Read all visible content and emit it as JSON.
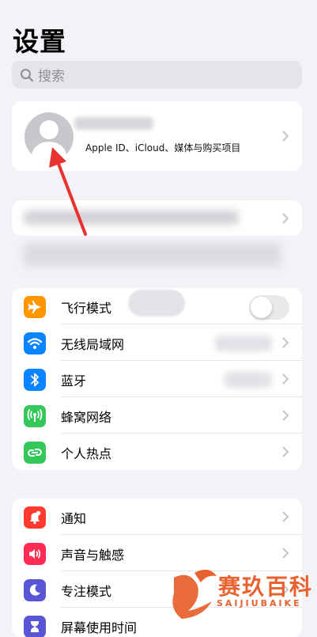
{
  "page_title": "设置",
  "search": {
    "placeholder": "搜索",
    "icon": "search-icon"
  },
  "profile": {
    "subtitle": "Apple ID、iCloud、媒体与购买项目"
  },
  "group1": [
    {
      "label": "飞行模式",
      "icon": "airplane-icon",
      "color": "#ff9500",
      "accessory": "toggle",
      "toggle_on": false
    },
    {
      "label": "无线局域网",
      "icon": "wifi-icon",
      "color": "#0a84ff",
      "accessory": "chevron"
    },
    {
      "label": "蓝牙",
      "icon": "bluetooth-icon",
      "color": "#0a84ff",
      "accessory": "chevron"
    },
    {
      "label": "蜂窝网络",
      "icon": "cellular-icon",
      "color": "#34c759",
      "accessory": "chevron"
    },
    {
      "label": "个人热点",
      "icon": "hotspot-icon",
      "color": "#34c759",
      "accessory": "chevron"
    }
  ],
  "group2": [
    {
      "label": "通知",
      "icon": "notifications-icon",
      "color": "#ff3b30"
    },
    {
      "label": "声音与触感",
      "icon": "sounds-icon",
      "color": "#ff2d55"
    },
    {
      "label": "专注模式",
      "icon": "focus-moon-icon",
      "color": "#5856d6"
    },
    {
      "label": "屏幕使用时间",
      "icon": "screen-time-icon",
      "color": "#5856d6"
    }
  ],
  "watermark": {
    "cn": "赛玖百科",
    "en": "SAIJIUBAIKE"
  }
}
